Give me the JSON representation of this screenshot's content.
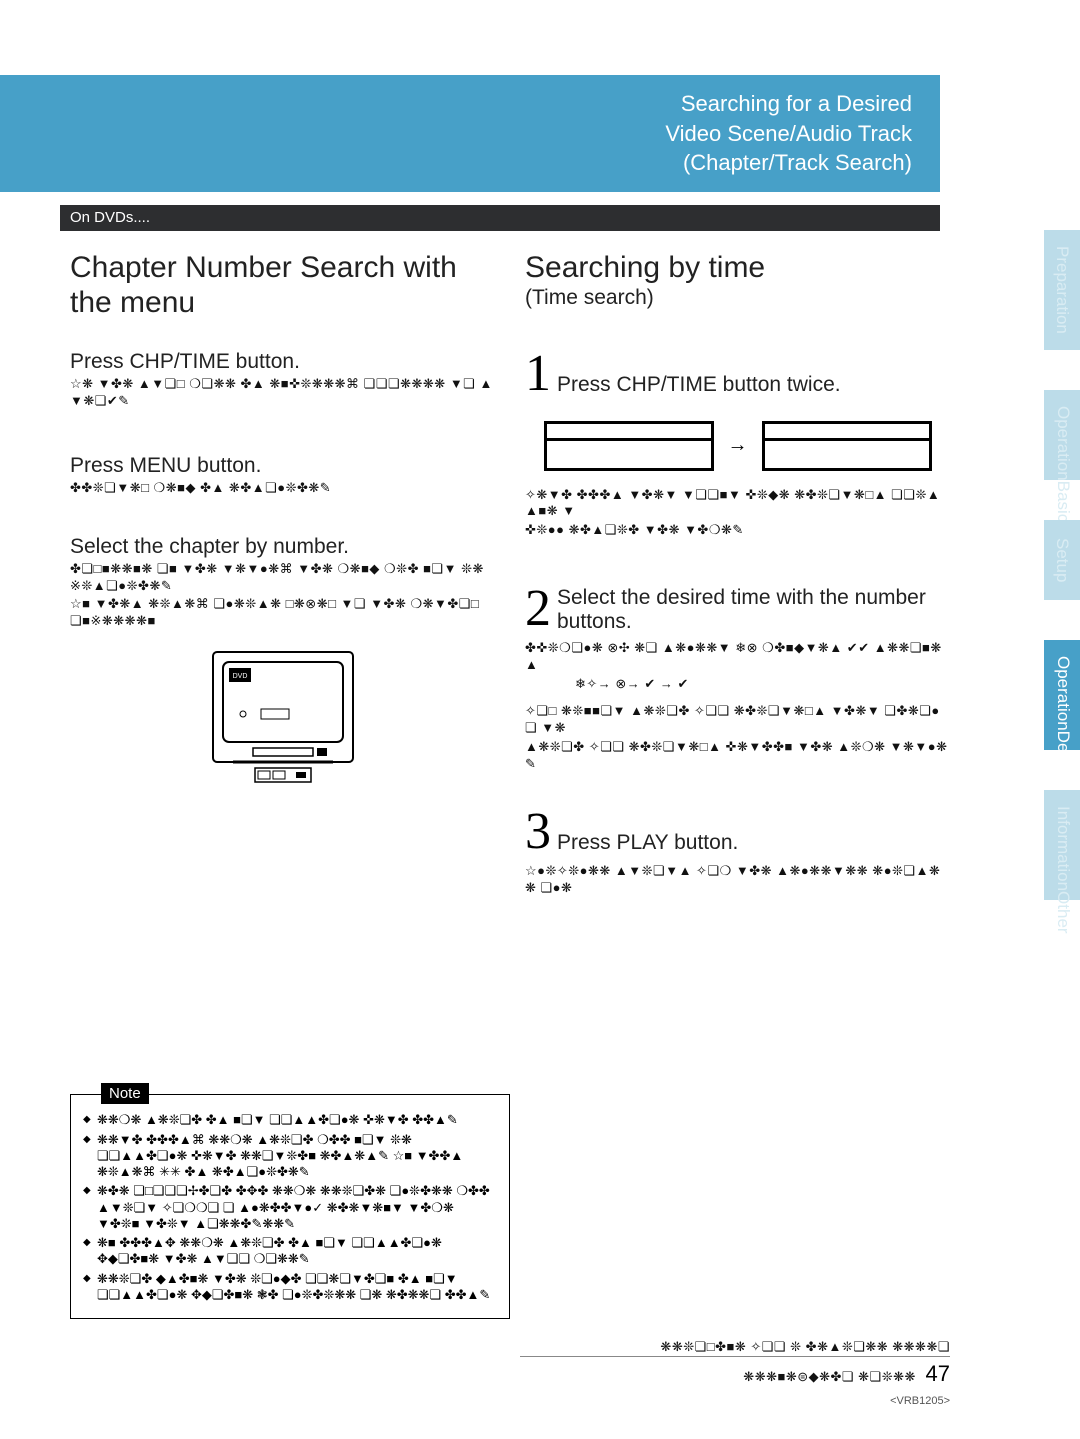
{
  "title": {
    "line1": "Searching for a Desired",
    "line2": "Video Scene/Audio Track",
    "line3": "(Chapter/Track Search)"
  },
  "strip": "On DVDs....",
  "left": {
    "heading": "Chapter Number Search with the menu",
    "step1": "Press CHP/TIME button.",
    "step1_g": "☆❋ ▼✤❋ ▲▼❏□ ❍❏❋❋ ✤▲ ❋■✜❊❋❋❋⌘ ❏❏❏❋❋❋❋ ▼❏ ▲▼❋❏✔✎",
    "step2": "Press MENU button.",
    "step2_g": "✤✤❊❏▼❋□ ❍❋■◆ ✤▲ ❋✤▲❏●❊✤❋✎",
    "step3": "Select the chapter by number.",
    "step3_g1": "✤❏□■❋❋■❋ ❏■ ▼✤❋ ▼❋▼●❋⌘ ▼✤❋ ❍❋■◆ ❍❊✤ ■❏▼ ❊❋ ※❊▲❏●❊✤❋✎",
    "step3_g2": "☆■ ▼✤❋▲ ❋❊▲❋⌘ ❏●❋❊▲❋ □❋⊗❋□ ▼❏ ▼✤❋ ❍❋▼✤❏□ ❏■※❋❋❋❋■"
  },
  "right": {
    "heading": "Searching by time",
    "sub": "(Time search)",
    "num1": "1",
    "step1": "Press CHP/TIME button twice.",
    "g_after_boxes1": "✧❋▼✤ ✤✤✤▲ ▼✤❋▼ ▼❏❏■▼ ✜❊◆❋ ❋✤❊❏▼❋□▲ ❏❏❊▲▲■❋ ▼",
    "g_after_boxes2": "✜❊●● ❋✤▲❏❊✤ ▼✤❋ ▼✤❍❋✎",
    "num2": "2",
    "step2a": "Select the desired time with the number",
    "step2b": "buttons.",
    "g2a": "✤✜❊❍❏●❋ ⊗✣ ❋❏ ▲❋●❋❋▼ ❄⊗ ❍✤■◆▼❋▲ ✔✔ ▲❋❋❏■❋▲",
    "g2b": "❄✧→ ⊗→ ✔ → ✔",
    "g2c": "✧❏□ ❋❊■■❏▼ ▲❋❊❏✤ ✧❏❏ ❋✤❊❏▼❋□▲ ▼✤❋▼ ❏✤❋❏●❏ ▼❋",
    "g2d": "▲❋❊❏✤ ✧❏❏ ❋✤❊❏▼❋□▲ ✜❋▼✤✤■ ▼✤❋ ▲❊❍❋ ▼❋▼●❋✎",
    "num3": "3",
    "step3": "Press PLAY button.",
    "g3": "☆●❊✧❊●❋❋ ▲▼❊❏▼▲ ✧❏❍ ▼✤❋ ▲❋●❋❋▼❋❋ ❋●❊❏▲❋❋ ❏●❋"
  },
  "note": {
    "label": "Note",
    "items": [
      "❋❋❍❋ ▲❋❊❏✤ ✤▲ ■❏▼ ❏❏▲▲✤❏●❋ ✜❋▼✤ ✤✤▲✎",
      "❋❋▼✤ ✤✤✤▲⌘ ❋❋❍❋ ▲❋❊❏✤ ❍✤✤ ■❏▼ ❊❋ ❏❏▲▲✤❏●❋ ✜❋▼✤ ❋❋❏▼❊✤■ ❋✤▲❋▲✎ ☆■ ▼✤✤▲ ❋❊▲❋⌘ ✳✳ ✤▲ ❋✤▲❏●❊✤❋✎",
      "❋✤❋ ❏□❏❏❏✢✤❏✤ ✤✥✤ ❋❋❍❋ ❋❋❊❏✤❋ ❏●❊✤❋❋ ❍✤✤ ▲▼❊❏▼ ✧❏❍❍❏ ❏ ▲●❋✤✤▼●✓ ❋✤❋▼❋■▼ ▼✤❍❋ ▼✤❊■ ▼✤❊▼ ▲❏❋❋✤✎❋❋✎",
      "❋■ ✤✤✤▲✥ ❋❋❍❋ ▲❋❊❏✤ ✤▲ ■❏▼ ❏❏▲▲✤❏●❋ ✥◆❏✤■❋ ▼✤❋ ▲▼❏❏ ❍❏❋❋✎",
      "❋❋❊❏✤ ◆▲✤■❋ ▼✤❋ ❊❏●◆✤ ❏❏❋❏▼✤❏■ ✤▲ ■❏▼ ❏❏▲▲✤❏●❋ ✥◆❏✤■❋ ❃✤ ❏●❊✤❊❋❋ ❏❋ ❋✤❋❋❏ ✤✤▲✎"
    ]
  },
  "tabs": {
    "t1": "Preparation",
    "t2a": "Basic",
    "t2b": "Operation",
    "t3": "Setup",
    "t4a": "Detailed",
    "t4b": "Operation",
    "t5a": "Other",
    "t5b": "Information"
  },
  "footer": {
    "g1": "❋❋❊❏□✤■❋ ✧❏❏ ❊ ✤❋▲❊❏❋❋ ❋❋❋❋❏",
    "g2": "❋❋❋■❋⊜◆❋✤❏ ❋❏❊❋❋",
    "page": "47",
    "vrb": "<VRB1205>"
  }
}
